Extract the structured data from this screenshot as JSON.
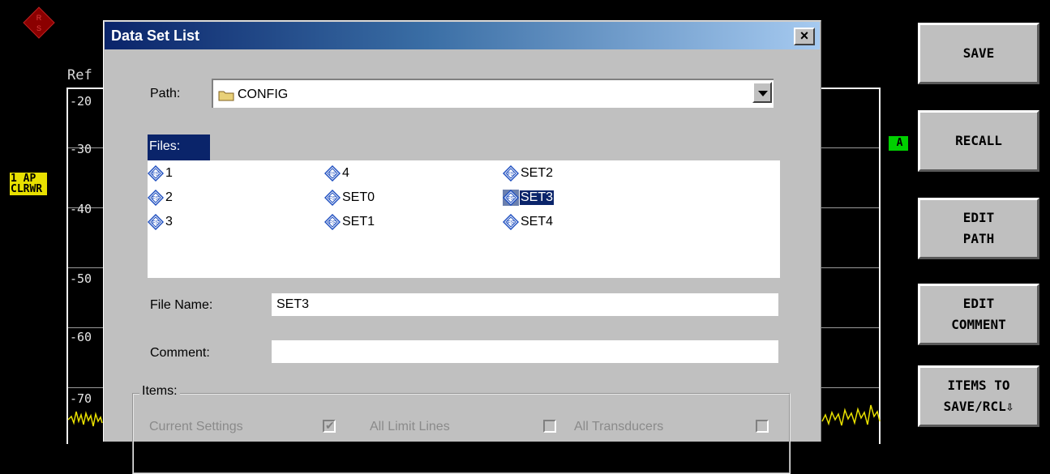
{
  "screen": {
    "ref_label": "Ref",
    "ref_ticks": [
      "-20",
      "-30",
      "-40",
      "-50",
      "-60",
      "-70"
    ],
    "trace_info": [
      "1 AP",
      "CLRWR"
    ],
    "marker_label": "A",
    "colors": {
      "trace": "#e8e000",
      "marker": "#00d000",
      "grid": "#9a9a9a"
    }
  },
  "softkeys": [
    {
      "lines": [
        "SAVE"
      ]
    },
    {
      "lines": [
        "RECALL"
      ]
    },
    {
      "lines": [
        "EDIT",
        "PATH"
      ]
    },
    {
      "lines": [
        "EDIT",
        "COMMENT"
      ]
    },
    {
      "lines": [
        "ITEMS TO",
        "SAVE/RCL⇩"
      ]
    }
  ],
  "dialog": {
    "title": "Data Set List",
    "close_symbol": "×",
    "path_label": "Path:",
    "path_value": "CONFIG",
    "files_label": "Files:",
    "files": [
      {
        "name": "1",
        "selected": false
      },
      {
        "name": "2",
        "selected": false
      },
      {
        "name": "3",
        "selected": false
      },
      {
        "name": "4",
        "selected": false
      },
      {
        "name": "SET0",
        "selected": false
      },
      {
        "name": "SET1",
        "selected": false
      },
      {
        "name": "SET2",
        "selected": false
      },
      {
        "name": "SET3",
        "selected": true
      },
      {
        "name": "SET4",
        "selected": false
      }
    ],
    "file_name_label": "File Name:",
    "file_name_value": "SET3",
    "comment_label": "Comment:",
    "comment_value": "",
    "items_label": "Items:",
    "items": [
      {
        "label": "Current Settings",
        "checked": true
      },
      {
        "label": "All Limit Lines",
        "checked": false
      },
      {
        "label": "All Transducers",
        "checked": false
      }
    ]
  }
}
